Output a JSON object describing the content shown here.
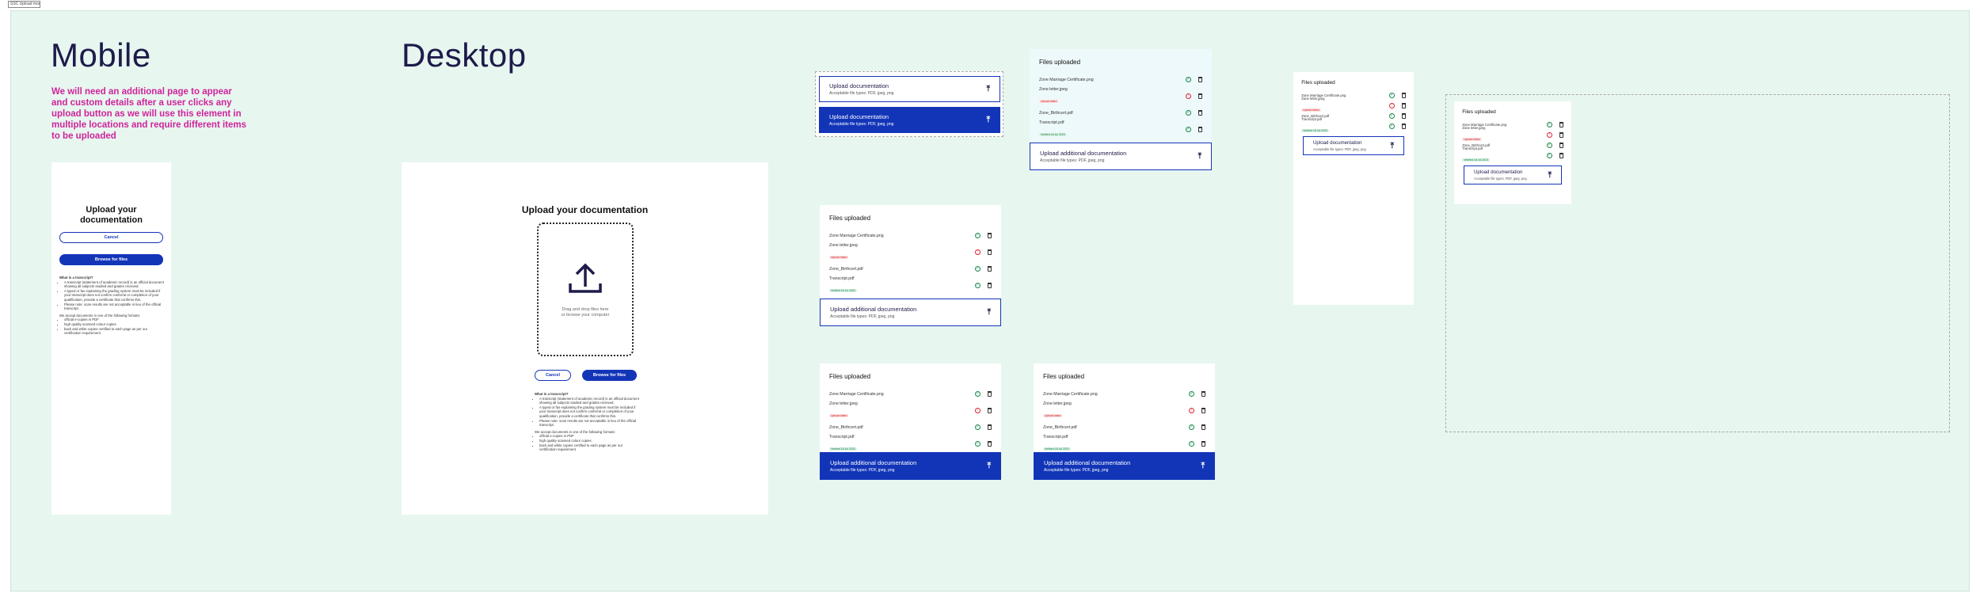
{
  "canvas_label": "SSC Upload module",
  "headings": {
    "mobile": "Mobile",
    "desktop": "Desktop"
  },
  "note": "We will need an additional page to appear and custom details after a user clicks any upload button as we will use this element in multiple locations and require different items to be uploaded",
  "page": {
    "mobile_title": "Upload your documentation",
    "desktop_title": "Upload your documentation",
    "cancel": "Cancel",
    "browse": "Browse for files",
    "dropzone_line1": "Drag and drop files here",
    "dropzone_line2": "or browse your computer",
    "help_heading": "What is a transcript?",
    "help_items": [
      "A transcript (statement of academic record) is an official document showing all subjects studied and grades received.",
      "A typed or fax explaining the grading system must be included if your transcript does not confirm conferral or completion of your qualification, provide a certificate that confirms this.",
      "Please note: scan results are not acceptable in lieu of the official transcript."
    ],
    "formats_heading": "We accept documents in one of the following formats:",
    "formats": [
      "official e-copies in PDF",
      "high quality scanned colour copies",
      "back and white copies certified to each page as per our certification requirement"
    ]
  },
  "upload": {
    "title": "Upload documentation",
    "title_additional": "Upload additional documentation",
    "subtitle": "Acceptable file types: PDF, jpeg, png",
    "upload_icon": "upload-icon"
  },
  "files": {
    "title": "Files uploaded",
    "items": [
      {
        "name": "Zone Marriage Certificate.png",
        "status": "ok",
        "badge": ""
      },
      {
        "name": "Zone letter.jpeg",
        "status": "error",
        "badge": "Upload failed"
      },
      {
        "name": "Zone_Birthcert.pdf",
        "status": "ok",
        "badge": ""
      },
      {
        "name": "Transcript.pdf",
        "status": "ok",
        "badge": "Verified 18 Jul 2023"
      }
    ]
  },
  "colors": {
    "canvas": "#e7f6ef",
    "primary": "#1235b8",
    "accent_text": "#d0239b",
    "heading": "#1e1b4b"
  }
}
